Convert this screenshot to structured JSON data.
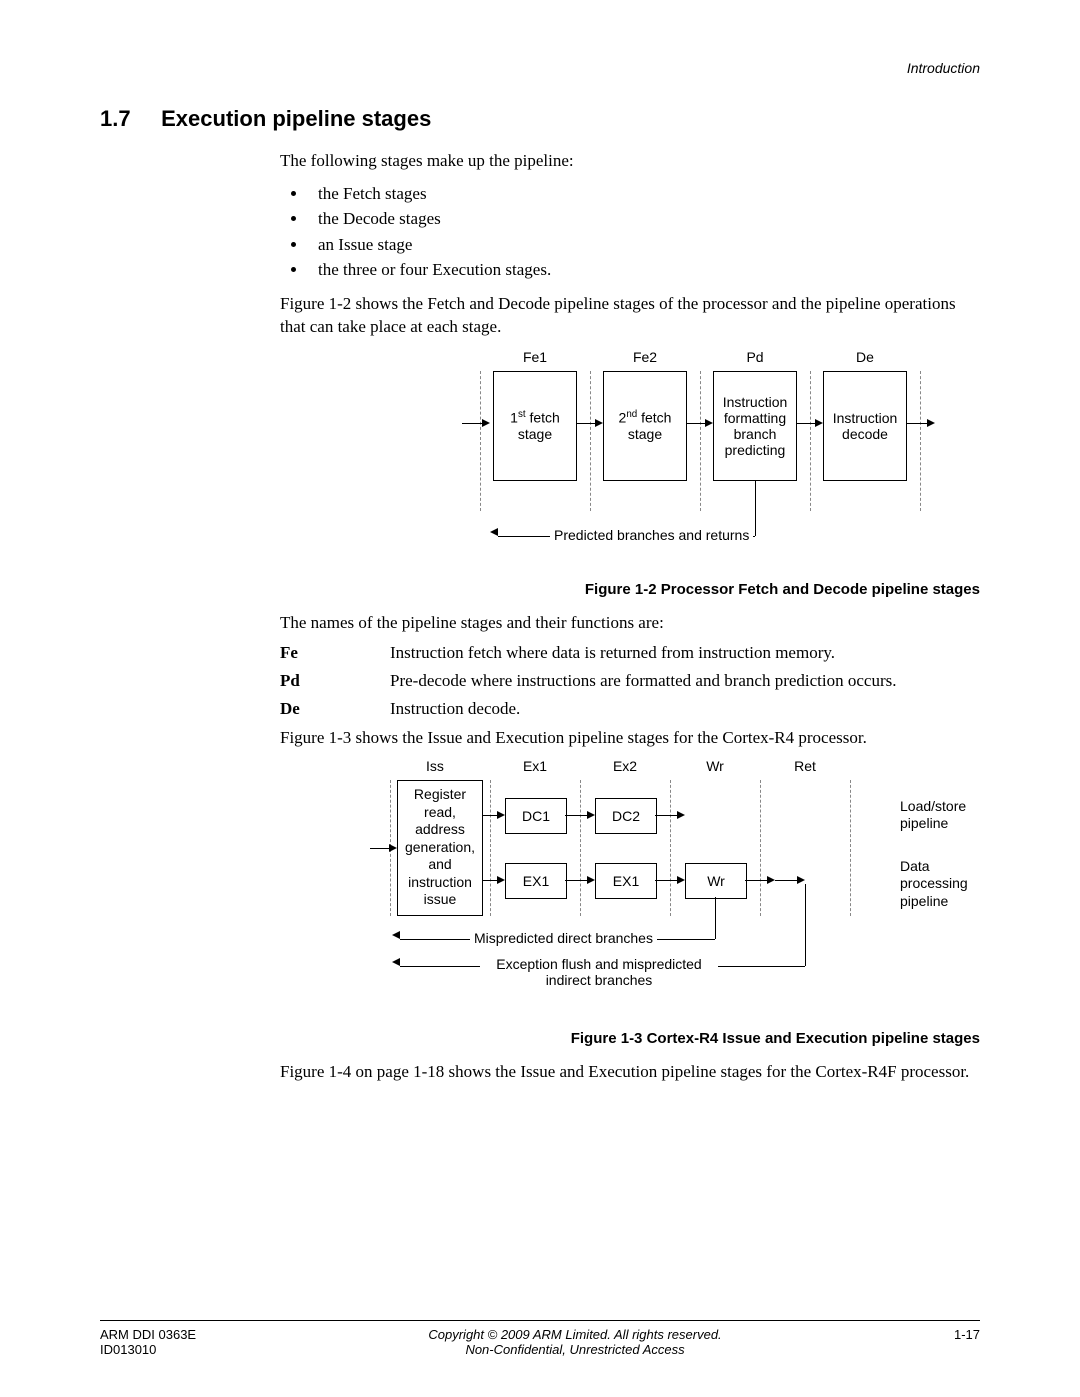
{
  "running_head": "Introduction",
  "section": {
    "number": "1.7",
    "title": "Execution pipeline stages"
  },
  "intro": "The following stages make up the pipeline:",
  "bullets": [
    "the Fetch stages",
    "the Decode stages",
    "an Issue stage",
    "the three or four Execution stages."
  ],
  "para_after_bullets": "Figure 1-2 shows the Fetch and Decode pipeline stages of the processor and the pipeline operations that can take place at each stage.",
  "fig12": {
    "cols": [
      "Fe1",
      "Fe2",
      "Pd",
      "De"
    ],
    "boxes": {
      "fe1_pre": "1",
      "fe1_sup": "st",
      "fe1_post": " fetch stage",
      "fe2_pre": "2",
      "fe2_sup": "nd",
      "fe2_post": " fetch stage",
      "pd": "Instruction formatting branch predicting",
      "de": "Instruction decode"
    },
    "feedback": "Predicted branches and returns",
    "caption": "Figure 1-2 Processor Fetch and Decode pipeline stages"
  },
  "names_intro": "The names of the pipeline stages and their functions are:",
  "defs": [
    {
      "term": "Fe",
      "desc": "Instruction fetch where data is returned from instruction memory."
    },
    {
      "term": "Pd",
      "desc": "Pre-decode where instructions are formatted and branch prediction occurs."
    },
    {
      "term": "De",
      "desc": "Instruction decode."
    }
  ],
  "para_before_fig13": "Figure 1-3 shows the Issue and Execution pipeline stages for the Cortex-R4 processor.",
  "fig13": {
    "cols": [
      "Iss",
      "Ex1",
      "Ex2",
      "Wr",
      "Ret"
    ],
    "bigbox": "Register read, address generation, and instruction issue",
    "dc1": "DC1",
    "dc2": "DC2",
    "ex1a": "EX1",
    "ex1b": "EX1",
    "wr": "Wr",
    "label_top": "Load/store pipeline",
    "label_bot": "Data processing pipeline",
    "fb1": "Mispredicted direct branches",
    "fb2": "Exception flush and mispredicted indirect branches",
    "caption": "Figure 1-3 Cortex-R4 Issue and Execution pipeline stages"
  },
  "para_after_fig13": "Figure 1-4 on page 1-18 shows the Issue and Execution pipeline stages for the Cortex-R4F processor.",
  "footer": {
    "doc_num": "ARM DDI 0363E",
    "doc_id": "ID013010",
    "copyright": "Copyright © 2009 ARM Limited. All rights reserved.",
    "classification": "Non-Confidential, Unrestricted Access",
    "page": "1-17"
  }
}
